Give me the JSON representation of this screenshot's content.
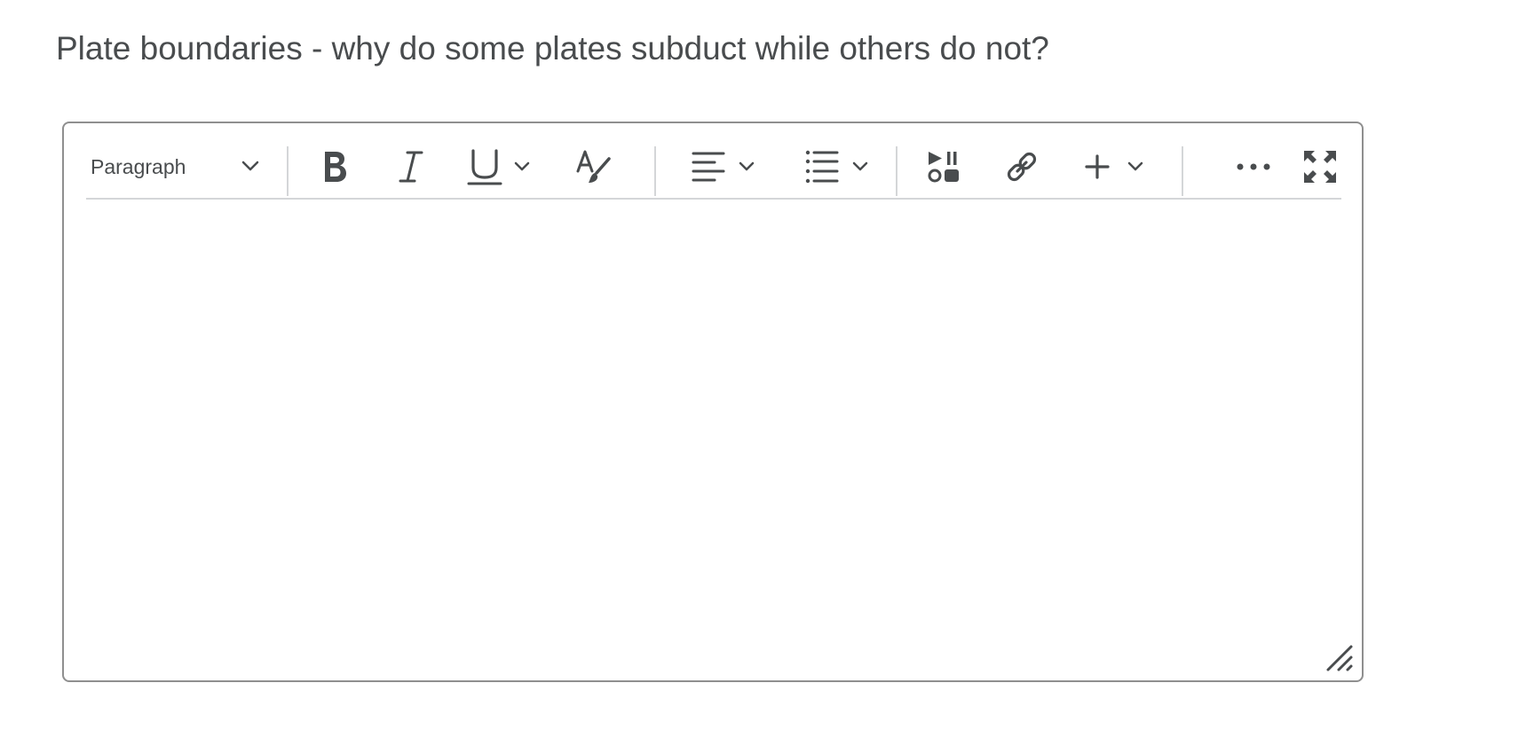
{
  "question": {
    "title": "Plate boundaries - why do some plates subduct while others do not?"
  },
  "editor": {
    "format_select": {
      "value": "Paragraph",
      "icon": "chevron-down-icon"
    },
    "toolbar_buttons": [
      {
        "name": "bold",
        "icon": "bold-icon"
      },
      {
        "name": "italic",
        "icon": "italic-icon"
      },
      {
        "name": "underline",
        "icon": "underline-icon",
        "dropdown": true
      },
      {
        "name": "text-color",
        "icon": "text-color-brush-icon"
      },
      {
        "name": "align",
        "icon": "align-left-icon",
        "dropdown": true
      },
      {
        "name": "list",
        "icon": "bullet-list-icon",
        "dropdown": true
      },
      {
        "name": "media",
        "icon": "media-icon"
      },
      {
        "name": "link",
        "icon": "link-icon"
      },
      {
        "name": "insert",
        "icon": "plus-icon",
        "dropdown": true
      },
      {
        "name": "more",
        "icon": "more-horizontal-icon"
      },
      {
        "name": "fullscreen",
        "icon": "fullscreen-icon"
      }
    ],
    "content": ""
  },
  "colors": {
    "text": "#494c4e",
    "border": "#8f8f8f",
    "divider": "#d4d6d8",
    "background": "#ffffff"
  }
}
